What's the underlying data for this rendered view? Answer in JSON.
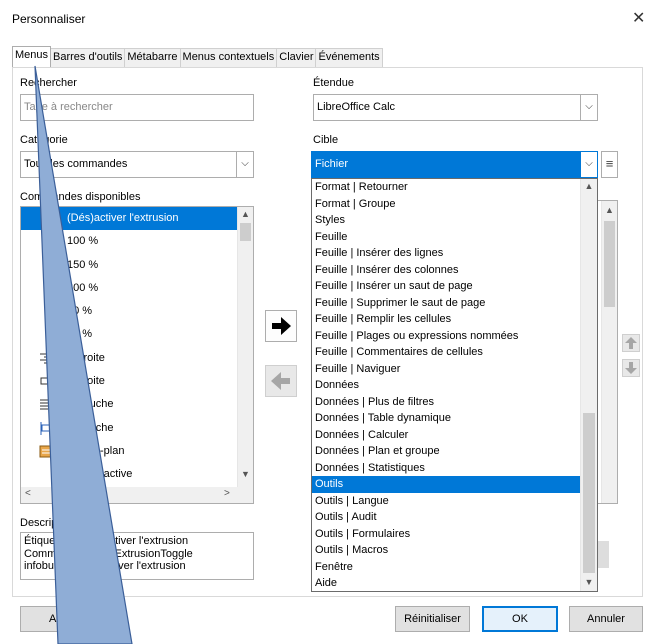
{
  "window": {
    "title": "Personnaliser",
    "close_icon": "✕"
  },
  "tabs": [
    {
      "label": "Menus",
      "active": true
    },
    {
      "label": "Barres d'outils"
    },
    {
      "label": "Métabarre"
    },
    {
      "label": "Menus contextuels"
    },
    {
      "label": "Clavier"
    },
    {
      "label": "Événements"
    }
  ],
  "search": {
    "label": "Rechercher",
    "placeholder": "Tape à rechercher"
  },
  "category": {
    "label": "Catégorie",
    "value": "Tous les commandes"
  },
  "commands": {
    "label": "Commandes disponibles",
    "items": [
      "(Dés)activer l'extrusion",
      "100 %",
      "150 %",
      "200 %",
      "50 %",
      "75 %",
      "À droite",
      "À droite",
      "À gauche",
      "À gauche",
      "Arrière-plan",
      "Cellule active"
    ]
  },
  "scope": {
    "label": "Étendue",
    "value": "LibreOffice Calc"
  },
  "target": {
    "label": "Cible",
    "value": "Fichier",
    "menu_icon": "≡",
    "dropdown": [
      "Format | Retourner",
      "Format | Groupe",
      "Styles",
      "Feuille",
      "Feuille | Insérer des lignes",
      "Feuille | Insérer des colonnes",
      "Feuille | Insérer un saut de page",
      "Feuille | Supprimer le saut de page",
      "Feuille | Remplir les cellules",
      "Feuille | Plages ou expressions nommées",
      "Feuille | Commentaires de cellules",
      "Feuille | Naviguer",
      "Données",
      "Données | Plus de filtres",
      "Données | Table dynamique",
      "Données | Calculer",
      "Données | Plan et groupe",
      "Données | Statistiques",
      "Outils",
      "Outils | Langue",
      "Outils | Audit",
      "Outils | Formulaires",
      "Outils | Macros",
      "Fenêtre",
      "Aide"
    ],
    "selected_index": 18
  },
  "description": {
    "label": "Description",
    "lines": [
      "Étiquette : (Dés)activer l'extrusion",
      "Commande : .uno:ExtrusionToggle",
      "infobulle : (Dés)activer l'extrusion"
    ]
  },
  "buttons": {
    "help": "Aide",
    "reset": "Réinitialiser",
    "ok": "OK",
    "cancel": "Annuler"
  },
  "colors": {
    "accent": "#0078d7",
    "overlay_fill": "#8fadd6",
    "overlay_stroke": "#3b5f99"
  }
}
